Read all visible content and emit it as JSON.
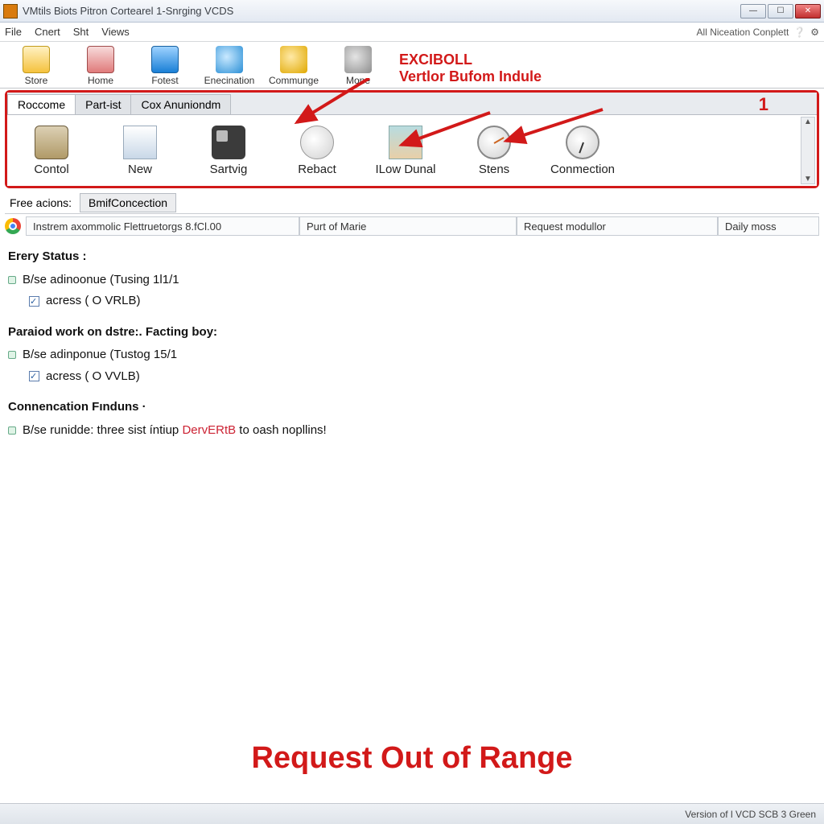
{
  "window": {
    "title": "VMtils Biots Pitron Cortearel 1-Snrging VCDS"
  },
  "menu": {
    "items": [
      "File",
      "Cnert",
      "Sht",
      "Views"
    ],
    "right": "All Niceation Conplett"
  },
  "main_toolbar": {
    "items": [
      "Store",
      "Home",
      "Fotest",
      "Enecination",
      "Communge",
      "Mone"
    ]
  },
  "top_annotation": {
    "line1": "EXCIBOLL",
    "line2": "Vertlor Bufom Indule"
  },
  "red_label": "1",
  "tabs": {
    "items": [
      "Roccome",
      "Part-ist",
      "Cox Anuniondm"
    ],
    "active_index": 0
  },
  "ribbon": {
    "items": [
      "Contol",
      "New",
      "Sartvig",
      "Rebact",
      "ILow Dunal",
      "Stens",
      "Conmection"
    ]
  },
  "free_actions": {
    "label": "Free acions:",
    "tabs": [
      "BmifConcection"
    ]
  },
  "columns": {
    "c1": "Instrem axommolic Flettruetorgs 8.fCl.00",
    "c2": "Purt of Marie",
    "c3": "Request modullor",
    "c4": "Daily moss"
  },
  "content": {
    "sec1_title": "Erery Status :",
    "sec1_r1": "B/se  adinoonue (Tusing 1l1/1",
    "sec1_r2": "acress ( O VRLB)",
    "sec2_title": "Paraiod work on dstre:. Facting boy:",
    "sec2_r1": "B/se  adinponue (Tustog 15/1",
    "sec2_r2": "acress ( O VVLB)",
    "sec3_title": "Connencation Fınduns ·",
    "sec3_pre": "B/se runidde: three sist íntiup ",
    "sec3_red": "DervERtB",
    "sec3_post": " to oash nopllins!"
  },
  "big_message": "Request Out of Range",
  "status": "Version of l VCD SCB 3 Green"
}
